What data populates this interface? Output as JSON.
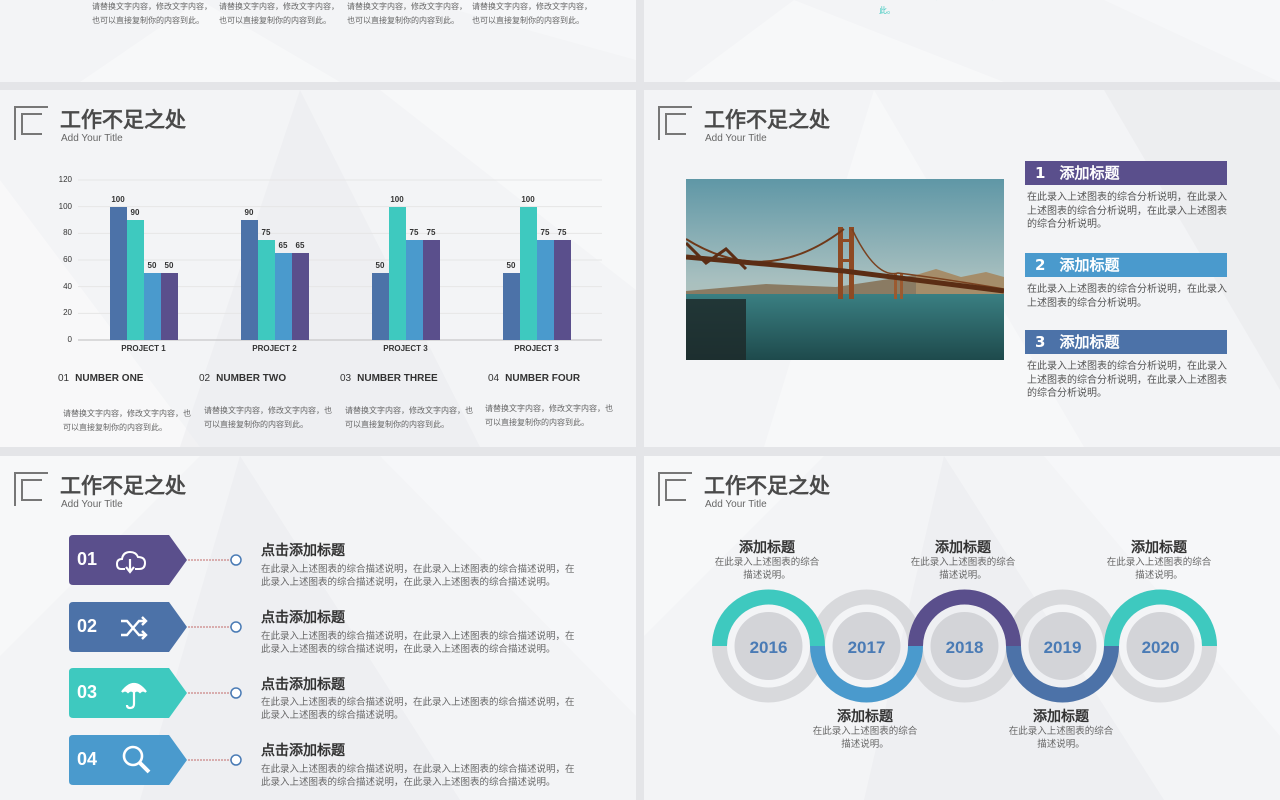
{
  "colors": {
    "purple": "#5a4f8c",
    "teal": "#3ec9bf",
    "blue": "#4a9acd",
    "navy": "#4c72a8",
    "grey": "#d8d9dc",
    "bg": "#f3f4f6"
  },
  "top_left": {
    "cells": [
      "请替换文字内容，修改文字内容，也可以直接复制你的内容到此。",
      "请替换文字内容，修改文字内容，也可以直接复制你的内容到此。",
      "请替换文字内容，修改文字内容，也可以直接复制你的内容到此。",
      "请替换文字内容，修改文字内容，也可以直接复制你的内容到此。"
    ]
  },
  "top_right": {
    "text": "请替换文字内容，修改文字内容，也可以直接复制你的内容到此。"
  },
  "slide_chart": {
    "title": "工作不足之处",
    "subtitle": "Add Your Title",
    "items": [
      {
        "num": "01",
        "label": "NUMBER  ONE",
        "desc": "请替换文字内容，修改文字内容，也可以直接复制你的内容到此。"
      },
      {
        "num": "02",
        "label": "NUMBER  TWO",
        "desc": "请替换文字内容，修改文字内容，也可以直接复制你的内容到此。"
      },
      {
        "num": "03",
        "label": "NUMBER  THREE",
        "desc": "请替换文字内容，修改文字内容，也可以直接复制你的内容到此。"
      },
      {
        "num": "04",
        "label": "NUMBER  FOUR",
        "desc": "请替换文字内容，修改文字内容，也可以直接复制你的内容到此。"
      }
    ]
  },
  "chart_data": {
    "type": "bar",
    "categories": [
      "PROJECT 1",
      "PROJECT 2",
      "PROJECT 3",
      "PROJECT 3"
    ],
    "series": [
      {
        "values": [
          100,
          90,
          50,
          50
        ],
        "color": "#4c72a8"
      },
      {
        "values": [
          90,
          75,
          100,
          100
        ],
        "color": "#3ec9bf"
      },
      {
        "values": [
          50,
          65,
          75,
          75
        ],
        "color": "#4a9acd"
      },
      {
        "values": [
          50,
          65,
          75,
          75
        ],
        "color": "#5a4f8c"
      }
    ],
    "yticks": [
      "0",
      "20",
      "40",
      "60",
      "80",
      "100",
      "120"
    ],
    "ylim": [
      0,
      120
    ],
    "grid": true
  },
  "slide_image": {
    "title": "工作不足之处",
    "subtitle": "Add Your Title",
    "items": [
      {
        "num": "1",
        "label": "添加标题",
        "color": "#5a4f8c",
        "desc": "在此录入上述图表的综合分析说明，在此录入上述图表的综合分析说明，在此录入上述图表的综合分析说明。"
      },
      {
        "num": "2",
        "label": "添加标题",
        "color": "#4a9acd",
        "desc": "在此录入上述图表的综合分析说明，在此录入上述图表的综合分析说明。"
      },
      {
        "num": "3",
        "label": "添加标题",
        "color": "#4c72a8",
        "desc": "在此录入上述图表的综合分析说明，在此录入上述图表的综合分析说明，在此录入上述图表的综合分析说明。"
      }
    ]
  },
  "slide_list": {
    "title": "工作不足之处",
    "subtitle": "Add Your Title",
    "items": [
      {
        "num": "01",
        "icon": "cloud-download-icon",
        "color": "#5a4f8c",
        "title": "点击添加标题",
        "desc": "在此录入上述图表的综合描述说明，在此录入上述图表的综合描述说明，在此录入上述图表的综合描述说明，在此录入上述图表的综合描述说明。"
      },
      {
        "num": "02",
        "icon": "shuffle-icon",
        "color": "#4c72a8",
        "title": "点击添加标题",
        "desc": "在此录入上述图表的综合描述说明，在此录入上述图表的综合描述说明，在此录入上述图表的综合描述说明，在此录入上述图表的综合描述说明。"
      },
      {
        "num": "03",
        "icon": "umbrella-icon",
        "color": "#3ec9bf",
        "title": "点击添加标题",
        "desc": "在此录入上述图表的综合描述说明，在此录入上述图表的综合描述说明，在此录入上述图表的综合描述说明。"
      },
      {
        "num": "04",
        "icon": "search-icon",
        "color": "#4a9acd",
        "title": "点击添加标题",
        "desc": "在此录入上述图表的综合描述说明，在此录入上述图表的综合描述说明，在此录入上述图表的综合描述说明，在此录入上述图表的综合描述说明。"
      }
    ]
  },
  "slide_timeline": {
    "title": "工作不足之处",
    "subtitle": "Add Your Title",
    "years": [
      "2016",
      "2017",
      "2018",
      "2019",
      "2020"
    ],
    "labels": [
      {
        "title": "添加标题",
        "desc": "在此录入上述图表的综合描述说明。"
      },
      {
        "title": "添加标题",
        "desc": "在此录入上述图表的综合描述说明。"
      },
      {
        "title": "添加标题",
        "desc": "在此录入上述图表的综合描述说明。"
      },
      {
        "title": "添加标题",
        "desc": "在此录入上述图表的综合描述说明。"
      },
      {
        "title": "添加标题",
        "desc": "在此录入上述图表的综合描述说明。"
      }
    ]
  }
}
